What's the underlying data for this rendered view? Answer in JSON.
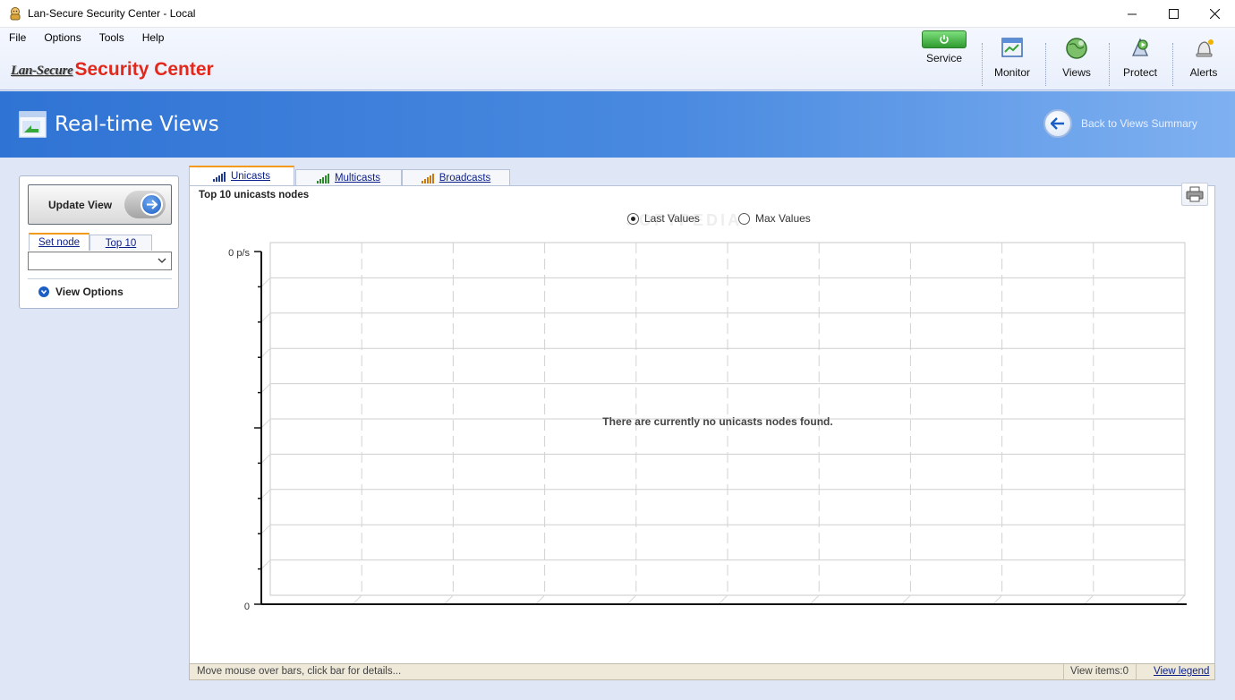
{
  "window": {
    "title": "Lan-Secure Security Center - Local"
  },
  "menu": [
    "File",
    "Options",
    "Tools",
    "Help"
  ],
  "logo": {
    "brand_small": "Lan-Secure",
    "brand_big": "Security Center"
  },
  "toolbar": {
    "service_label": "Service",
    "monitor_label": "Monitor",
    "views_label": "Views",
    "protect_label": "Protect",
    "alerts_label": "Alerts"
  },
  "banner": {
    "title": "Real-time Views",
    "back_link": "Back to Views Summary"
  },
  "left_panel": {
    "update_button": "Update View",
    "tabs": [
      "Set node",
      "Top 10"
    ],
    "node_select_value": "",
    "view_options": "View Options"
  },
  "tabs": [
    "Unicasts",
    "Multicasts",
    "Broadcasts"
  ],
  "content": {
    "section_title": "Top 10 unicasts nodes",
    "radio_last": "Last Values",
    "radio_max": "Max Values",
    "radio_selected": "Last Values",
    "watermark": "SOFTPEDIA"
  },
  "chart_data": {
    "type": "bar",
    "categories": [],
    "values": [],
    "ytick_top": "0 p/s",
    "ytick_bottom": "0",
    "grid": true,
    "empty_message": "There are currently no unicasts nodes found."
  },
  "statusbar": {
    "hint": "Move mouse over bars, click bar for details...",
    "view_items": "View items:0",
    "legend_link": "View legend"
  },
  "colors": {
    "banner_start": "#2f73d4",
    "banner_end": "#7fb1f1",
    "brand_red": "#e3271b",
    "active_tab_accent": "#f29b1a",
    "link_blue": "#0b1f8a"
  }
}
